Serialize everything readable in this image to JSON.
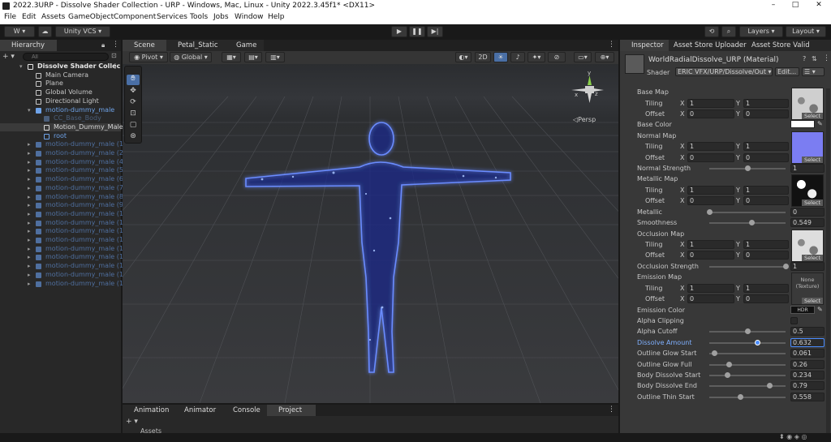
{
  "window": {
    "title": "2022.3URP - Dissolve Shader Collection - URP - Windows, Mac, Linux - Unity 2022.3.45f1* <DX11>",
    "minimize": "–",
    "maximize": "□",
    "close": "✕"
  },
  "menu": [
    "File",
    "Edit",
    "Assets",
    "GameObject",
    "Component",
    "Services",
    "Tools",
    "Jobs",
    "Window",
    "Help"
  ],
  "toolbar": {
    "account": "W ▾",
    "cloud_icon": "cloud-icon",
    "vcs": "Unity VCS ▾",
    "play_icon": "play-icon",
    "pause_icon": "pause-icon",
    "step_icon": "step-icon",
    "layers": "Layers",
    "layout": "Layout"
  },
  "hierarchy": {
    "tab": "Hierarchy",
    "search_placeholder": "All",
    "add": "+ ▾",
    "items": [
      {
        "label": "Dissolve Shader Collec",
        "indent": 0,
        "type": "scene",
        "color": "#e6e6e6",
        "arrow": "▾",
        "bold": true
      },
      {
        "label": "Main Camera",
        "indent": 1,
        "type": "go",
        "color": "#c8c8c8"
      },
      {
        "label": "Plane",
        "indent": 1,
        "type": "go",
        "color": "#c8c8c8"
      },
      {
        "label": "Global Volume",
        "indent": 1,
        "type": "go",
        "color": "#c8c8c8"
      },
      {
        "label": "Directional Light",
        "indent": 1,
        "type": "go",
        "color": "#c8c8c8"
      },
      {
        "label": "motion-dummy_male",
        "indent": 1,
        "type": "prefab",
        "color": "#6fa3e8",
        "arrow": "▾"
      },
      {
        "label": "CC_Base_Body",
        "indent": 2,
        "type": "prefab",
        "color": "#4a5e7a"
      },
      {
        "label": "Motion_Dummy_Male",
        "indent": 2,
        "type": "go",
        "color": "#d8d8d8",
        "selected": true
      },
      {
        "label": "root",
        "indent": 2,
        "type": "go",
        "color": "#6fa3e8"
      },
      {
        "label": "motion-dummy_male (1)",
        "indent": 1,
        "type": "prefab",
        "color": "#4f6f9f",
        "arrow": "▸"
      },
      {
        "label": "motion-dummy_male (2)",
        "indent": 1,
        "type": "prefab",
        "color": "#4f6f9f",
        "arrow": "▸"
      },
      {
        "label": "motion-dummy_male (4)",
        "indent": 1,
        "type": "prefab",
        "color": "#4f6f9f",
        "arrow": "▸"
      },
      {
        "label": "motion-dummy_male (5)",
        "indent": 1,
        "type": "prefab",
        "color": "#4f6f9f",
        "arrow": "▸"
      },
      {
        "label": "motion-dummy_male (6)",
        "indent": 1,
        "type": "prefab",
        "color": "#4f6f9f",
        "arrow": "▸"
      },
      {
        "label": "motion-dummy_male (7)",
        "indent": 1,
        "type": "prefab",
        "color": "#4f6f9f",
        "arrow": "▸"
      },
      {
        "label": "motion-dummy_male (8)",
        "indent": 1,
        "type": "prefab",
        "color": "#4f6f9f",
        "arrow": "▸"
      },
      {
        "label": "motion-dummy_male (9)",
        "indent": 1,
        "type": "prefab",
        "color": "#4f6f9f",
        "arrow": "▸"
      },
      {
        "label": "motion-dummy_male (10",
        "indent": 1,
        "type": "prefab",
        "color": "#4f6f9f",
        "arrow": "▸"
      },
      {
        "label": "motion-dummy_male (11",
        "indent": 1,
        "type": "prefab",
        "color": "#4f6f9f",
        "arrow": "▸"
      },
      {
        "label": "motion-dummy_male (12",
        "indent": 1,
        "type": "prefab",
        "color": "#4f6f9f",
        "arrow": "▸"
      },
      {
        "label": "motion-dummy_male (13",
        "indent": 1,
        "type": "prefab",
        "color": "#4f6f9f",
        "arrow": "▸"
      },
      {
        "label": "motion-dummy_male (14",
        "indent": 1,
        "type": "prefab",
        "color": "#4f6f9f",
        "arrow": "▸"
      },
      {
        "label": "motion-dummy_male (15",
        "indent": 1,
        "type": "prefab",
        "color": "#4f6f9f",
        "arrow": "▸"
      },
      {
        "label": "motion-dummy_male (16",
        "indent": 1,
        "type": "prefab",
        "color": "#4f6f9f",
        "arrow": "▸"
      },
      {
        "label": "motion-dummy_male (17",
        "indent": 1,
        "type": "prefab",
        "color": "#4f6f9f",
        "arrow": "▸"
      },
      {
        "label": "motion-dummy_male (18",
        "indent": 1,
        "type": "prefab",
        "color": "#4f6f9f",
        "arrow": "▸"
      }
    ]
  },
  "scene": {
    "tabs": [
      "Scene",
      "Petal_Static",
      "Game"
    ],
    "pivot": "Pivot",
    "global": "Global",
    "mode_2d": "2D",
    "persp": "◁Persp",
    "gizmo_y": "y",
    "gizmo_z": "z",
    "gizmo_x": "x"
  },
  "bottom": {
    "tabs": [
      "Animation",
      "Animator",
      "Console",
      "Project"
    ],
    "add": "+ ▾",
    "assets": "Assets"
  },
  "inspector": {
    "tabs": [
      "Inspector",
      "Asset Store Uploader",
      "Asset Store Valid"
    ],
    "material_name": "WorldRadialDissolve_URP (Material)",
    "shader_label": "Shader",
    "shader_value": "ERIC VFX/URP/Dissolve/Out ▾",
    "edit_button": "Edit...",
    "list_icon": "☰ ▾",
    "select": "Select",
    "none_texture": "None\n(Texture)",
    "hdr": "HDR",
    "props": [
      {
        "kind": "header",
        "label": "Base Map",
        "tex": "#cfcfcf"
      },
      {
        "kind": "xy",
        "label": "Tiling",
        "x": "1",
        "y": "1"
      },
      {
        "kind": "xy",
        "label": "Offset",
        "x": "0",
        "y": "0"
      },
      {
        "kind": "color",
        "label": "Base Color",
        "color": "#ffffff"
      },
      {
        "kind": "header",
        "label": "Normal Map",
        "tex": "#7b7df2"
      },
      {
        "kind": "xy",
        "label": "Tiling",
        "x": "1",
        "y": "1"
      },
      {
        "kind": "xy",
        "label": "Offset",
        "x": "0",
        "y": "0"
      },
      {
        "kind": "slider",
        "label": "Normal Strength",
        "value": "1",
        "frac": 0.5
      },
      {
        "kind": "header",
        "label": "Metallic Map",
        "tex": "#111111"
      },
      {
        "kind": "xy",
        "label": "Tiling",
        "x": "1",
        "y": "1"
      },
      {
        "kind": "xy",
        "label": "Offset",
        "x": "0",
        "y": "0"
      },
      {
        "kind": "slider",
        "label": "Metallic",
        "value": "0",
        "frac": 0
      },
      {
        "kind": "slider",
        "label": "Smoothness",
        "value": "0.549",
        "frac": 0.549
      },
      {
        "kind": "header",
        "label": "Occlusion Map",
        "tex": "#dedede"
      },
      {
        "kind": "xy",
        "label": "Tiling",
        "x": "1",
        "y": "1"
      },
      {
        "kind": "xy",
        "label": "Offset",
        "x": "0",
        "y": "0"
      },
      {
        "kind": "slider",
        "label": "Occlusion Strength",
        "value": "1",
        "frac": 1
      },
      {
        "kind": "header",
        "label": "Emission Map",
        "tex": "none"
      },
      {
        "kind": "xy",
        "label": "Tiling",
        "x": "1",
        "y": "1"
      },
      {
        "kind": "xy",
        "label": "Offset",
        "x": "0",
        "y": "0"
      },
      {
        "kind": "hdrcolor",
        "label": "Emission Color"
      },
      {
        "kind": "toggle",
        "label": "Alpha Clipping"
      },
      {
        "kind": "slider",
        "label": "Alpha Cutoff",
        "value": "0.5",
        "frac": 0.5
      },
      {
        "kind": "slider",
        "label": "Dissolve Amount",
        "value": "0.632",
        "frac": 0.632,
        "active": true
      },
      {
        "kind": "slider",
        "label": "Outline Glow Start",
        "value": "0.061",
        "frac": 0.061
      },
      {
        "kind": "slider",
        "label": "Outline Glow Full",
        "value": "0.26",
        "frac": 0.26
      },
      {
        "kind": "slider",
        "label": "Body Dissolve Start",
        "value": "0.234",
        "frac": 0.234
      },
      {
        "kind": "slider",
        "label": "Body Dissolve End",
        "value": "0.79",
        "frac": 0.79
      },
      {
        "kind": "slider",
        "label": "Outline Thin Start",
        "value": "0.558",
        "frac": 0.4
      }
    ]
  }
}
